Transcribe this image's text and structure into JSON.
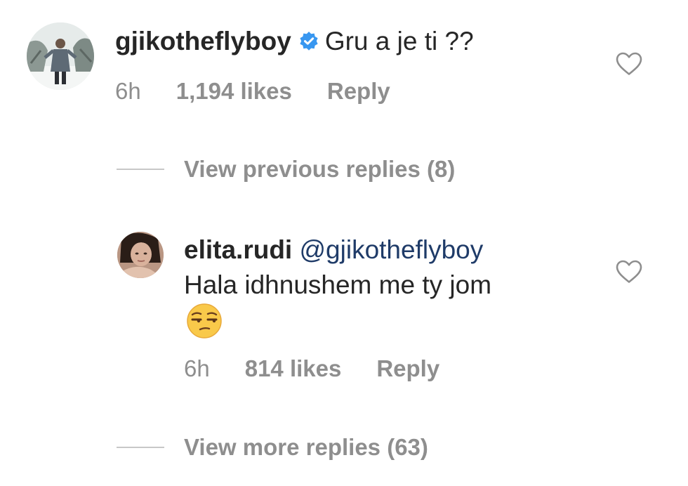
{
  "comment": {
    "username": "gjikotheflyboy",
    "verified_icon": "verified-badge-icon",
    "text": "Gru a je ti ??",
    "time": "6h",
    "likes": "1,194 likes",
    "reply_label": "Reply",
    "like_icon": "heart-outline-icon",
    "view_previous": "View previous replies (8)"
  },
  "reply": {
    "username": "elita.rudi",
    "mention": "@gjikotheflyboy",
    "text_line": "Hala idhnushem me ty jom",
    "emoji": "unamused-face-emoji",
    "time": "6h",
    "likes": "814 likes",
    "reply_label": "Reply",
    "like_icon": "heart-outline-icon",
    "view_more": "View more replies (63)"
  },
  "colors": {
    "text": "#262626",
    "secondary": "#8e8e8e",
    "mention": "#1f3b68",
    "verified": "#3897f0"
  }
}
